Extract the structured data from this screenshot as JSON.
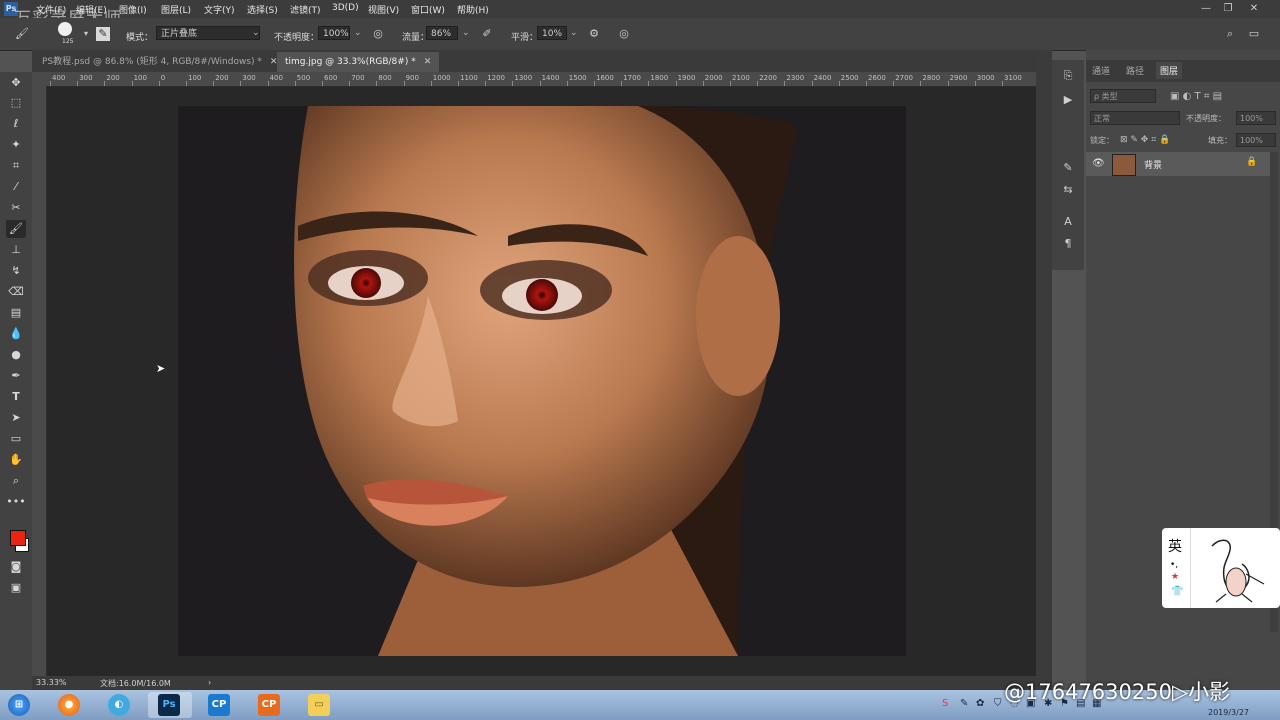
{
  "watermark_top": "万彩录屏大师",
  "menu": [
    "文件(F)",
    "编辑(E)",
    "图像(I)",
    "图层(L)",
    "文字(Y)",
    "选择(S)",
    "滤镜(T)",
    "3D(D)",
    "视图(V)",
    "窗口(W)",
    "帮助(H)"
  ],
  "options": {
    "brush_size": "125",
    "mode_label": "模式：",
    "mode_value": "正片叠底",
    "opacity_label": "不透明度：",
    "opacity_value": "100%",
    "flow_label": "流量：",
    "flow_value": "86%",
    "smooth_label": "平滑：",
    "smooth_value": "10%"
  },
  "tabs": [
    {
      "label": "PS教程.psd @ 86.8% (矩形 4, RGB/8#/Windows) *"
    },
    {
      "label": "timg.jpg @ 33.3%(RGB/8#) *"
    }
  ],
  "ruler_ticks": [
    "400",
    "300",
    "200",
    "100",
    "0",
    "100",
    "200",
    "300",
    "400",
    "500",
    "600",
    "700",
    "800",
    "900",
    "1000",
    "1100",
    "1200",
    "1300",
    "1400",
    "1500",
    "1600",
    "1700",
    "1800",
    "1900",
    "2000",
    "2100",
    "2200",
    "2300",
    "2400",
    "2500",
    "2600",
    "2700",
    "2800",
    "2900",
    "3000",
    "3100"
  ],
  "status": {
    "zoom": "33.33%",
    "doc": "文档:16.0M/16.0M"
  },
  "panels": {
    "tabs": [
      "通道",
      "路径",
      "图层"
    ],
    "kind_label": "ρ 类型",
    "blend_mode": "正常",
    "opacity_label": "不透明度：",
    "opacity_value": "100%",
    "lock_label": "锁定：",
    "fill_label": "填充：",
    "fill_value": "100%",
    "layer_name": "背景"
  },
  "ime": {
    "char": "英"
  },
  "watermark_bottom": "@17647630250▷小影",
  "clock": "2019/3/27",
  "colors": {
    "foreground": "#e8260f",
    "background": "#ffffff"
  }
}
